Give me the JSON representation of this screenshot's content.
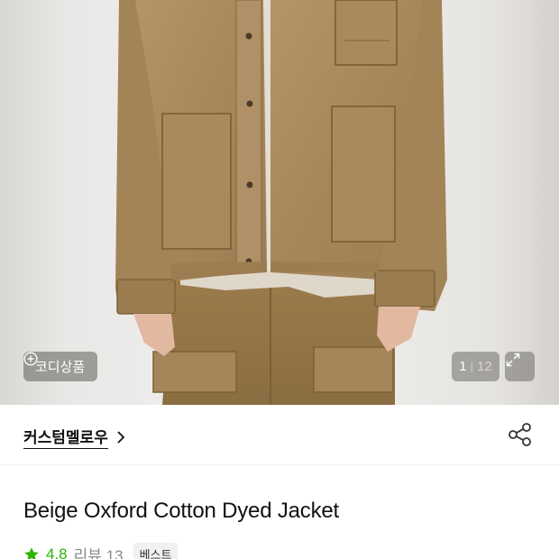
{
  "gallery": {
    "coord_button_label": "코디상품",
    "current_index": "1",
    "total_count": "12",
    "separator": "|"
  },
  "brand": {
    "name": "커스텀멜로우"
  },
  "product": {
    "title": "Beige Oxford Cotton Dyed Jacket",
    "rating": "4.8",
    "review_label": "리뷰 13",
    "badge": "베스트"
  },
  "icons": {
    "coord": "plus-circle-icon",
    "expand": "expand-arrows-icon",
    "brand_chevron": "chevron-right-icon",
    "share": "share-icon",
    "star": "star-icon"
  },
  "colors": {
    "rating_green": "#2db400",
    "jacket": "#a98a5a"
  }
}
